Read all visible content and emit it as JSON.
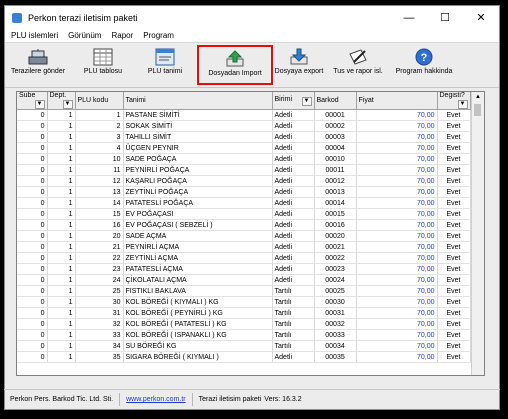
{
  "window": {
    "title": "Perkon terazi iletisim paketi"
  },
  "menu": [
    "PLU islemleri",
    "Görünüm",
    "Rapor",
    "Program"
  ],
  "toolbar": [
    {
      "label": "Terazilere gönder",
      "icon": "scale-send-icon"
    },
    {
      "label": "PLU tablosu",
      "icon": "table-icon"
    },
    {
      "label": "PLU tanimi",
      "icon": "window-icon"
    },
    {
      "label": "Dosyadan Import",
      "icon": "import-arrow-icon",
      "highlighted": true
    },
    {
      "label": "Dosyaya export",
      "icon": "export-arrow-icon"
    },
    {
      "label": "Tus ve rapor isl.",
      "icon": "pen-paper-icon"
    },
    {
      "label": "Program hakkinda",
      "icon": "help-icon"
    }
  ],
  "grid": {
    "columns": [
      "Sube",
      "Dept.",
      "PLU kodu",
      "Tanimi",
      "Birimi",
      "Barkod",
      "Fiyat",
      "Degisti?"
    ],
    "rows": [
      [
        "0",
        "1",
        "1",
        "PASTANE SİMİTİ",
        "Adetli",
        "00001",
        "70,00",
        "Evet"
      ],
      [
        "0",
        "1",
        "2",
        "SOKAK SİMİTİ",
        "Adetli",
        "00002",
        "70,00",
        "Evet"
      ],
      [
        "0",
        "1",
        "3",
        "TAHILLI SİMİT",
        "Adetli",
        "00003",
        "70,00",
        "Evet"
      ],
      [
        "0",
        "1",
        "4",
        "ÜÇGEN PEYNIR",
        "Adetli",
        "00004",
        "70,00",
        "Evet"
      ],
      [
        "0",
        "1",
        "10",
        "SADE POĞAÇA",
        "Adetli",
        "00010",
        "70,00",
        "Evet"
      ],
      [
        "0",
        "1",
        "11",
        "PEYNİRLİ POĞAÇA",
        "Adetli",
        "00011",
        "70,00",
        "Evet"
      ],
      [
        "0",
        "1",
        "12",
        "KAŞARLI POĞAÇA",
        "Adetli",
        "00012",
        "70,00",
        "Evet"
      ],
      [
        "0",
        "1",
        "13",
        "ZEYTİNLİ POĞAÇA",
        "Adetli",
        "00013",
        "70,00",
        "Evet"
      ],
      [
        "0",
        "1",
        "14",
        "PATATESLİ POĞAÇA",
        "Adetli",
        "00014",
        "70,00",
        "Evet"
      ],
      [
        "0",
        "1",
        "15",
        "EV POĞAÇASI",
        "Adetli",
        "00015",
        "70,00",
        "Evet"
      ],
      [
        "0",
        "1",
        "16",
        "EV POĞAÇASI ( SEBZELİ )",
        "Adetli",
        "00016",
        "70,00",
        "Evet"
      ],
      [
        "0",
        "1",
        "20",
        "SADE AÇMA",
        "Adetli",
        "00020",
        "70,00",
        "Evet"
      ],
      [
        "0",
        "1",
        "21",
        "PEYNİRLİ AÇMA",
        "Adetli",
        "00021",
        "70,00",
        "Evet"
      ],
      [
        "0",
        "1",
        "22",
        "ZEYTİNLİ AÇMA",
        "Adetli",
        "00022",
        "70,00",
        "Evet"
      ],
      [
        "0",
        "1",
        "23",
        "PATATESLİ AÇMA",
        "Adetli",
        "00023",
        "70,00",
        "Evet"
      ],
      [
        "0",
        "1",
        "24",
        "ÇİKOLATALI AÇMA",
        "Adetli",
        "00024",
        "70,00",
        "Evet"
      ],
      [
        "0",
        "1",
        "25",
        "FISTIKLI BAKLAVA",
        "Tartılı",
        "00025",
        "70,00",
        "Evet"
      ],
      [
        "0",
        "1",
        "30",
        "KOL BÖREĞİ ( KIYMALI ) KG",
        "Tartılı",
        "00030",
        "70,00",
        "Evet"
      ],
      [
        "0",
        "1",
        "31",
        "KOL BÖREĞİ ( PEYNİRLİ ) KG",
        "Tartılı",
        "00031",
        "70,00",
        "Evet"
      ],
      [
        "0",
        "1",
        "32",
        "KOL BÖREĞİ ( PATATESLİ ) KG",
        "Tartılı",
        "00032",
        "70,00",
        "Evet"
      ],
      [
        "0",
        "1",
        "33",
        "KOL BÖREĞİ ( ISPANAKLI ) KG",
        "Tartılı",
        "00033",
        "70,00",
        "Evet"
      ],
      [
        "0",
        "1",
        "34",
        "SU BÖREĞİ KG",
        "Tartılı",
        "00034",
        "70,00",
        "Evet"
      ],
      [
        "0",
        "1",
        "35",
        "SIGARA BÖREĞİ ( KIYMALI )",
        "Adetli",
        "00035",
        "70,00",
        "Evet"
      ]
    ]
  },
  "status": {
    "company": "Perkon Pers. Barkod Tic. Ltd. Sti.",
    "website": "www.perkon.com.tr",
    "product": "Terazi iletisim paketi",
    "version": "Vers: 16.3.2"
  },
  "colors": {
    "highlight": "#e01010",
    "link": "#1b3bd0",
    "accent": "#3b7fd6"
  }
}
